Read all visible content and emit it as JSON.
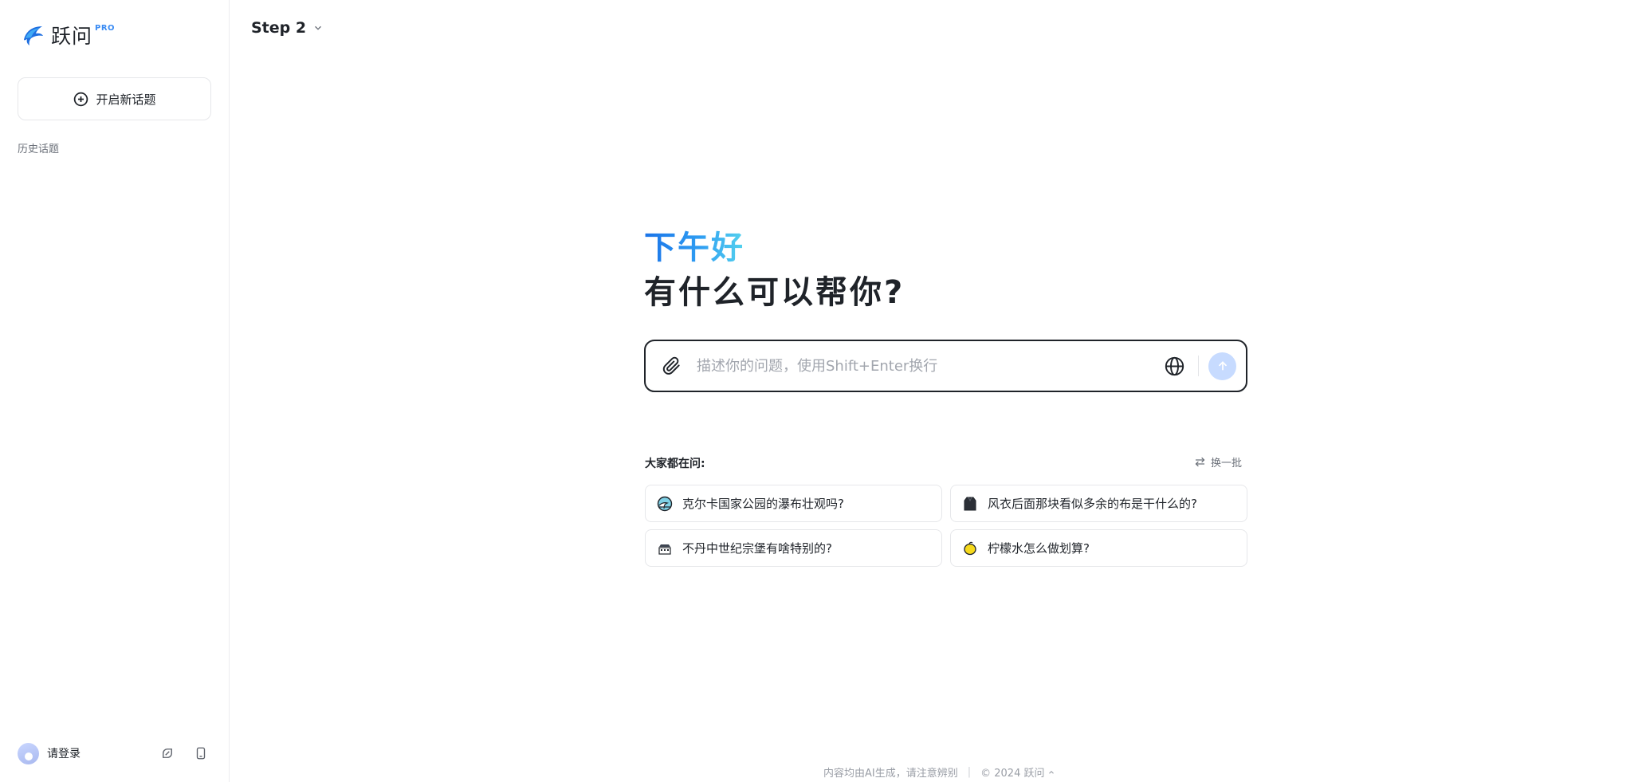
{
  "sidebar": {
    "brand": "跃问",
    "brand_badge": "PRO",
    "new_topic_label": "开启新话题",
    "history_label": "历史话题",
    "login_label": "请登录"
  },
  "header": {
    "model_name": "Step 2"
  },
  "main": {
    "greeting": "下午好",
    "subtitle": "有什么可以帮你?",
    "input_placeholder": "描述你的问题，使用Shift+Enter换行",
    "popular_label": "大家都在问:",
    "refresh_label": "换一批",
    "suggestions": [
      {
        "icon": "waterfall-icon",
        "text": "克尔卡国家公园的瀑布壮观吗?"
      },
      {
        "icon": "coat-icon",
        "text": "风衣后面那块看似多余的布是干什么的?"
      },
      {
        "icon": "castle-icon",
        "text": "不丹中世纪宗堡有啥特别的?"
      },
      {
        "icon": "lemon-icon",
        "text": "柠檬水怎么做划算?"
      }
    ]
  },
  "footer": {
    "disclaimer": "内容均由AI生成，请注意辨别",
    "copyright": "© 2024 跃问"
  },
  "colors": {
    "accent": "#1a73e8",
    "greeting_gradient_end": "#55d3ee",
    "send_button_disabled": "#c7dbff",
    "brand_badge": "#3a8bf3"
  }
}
